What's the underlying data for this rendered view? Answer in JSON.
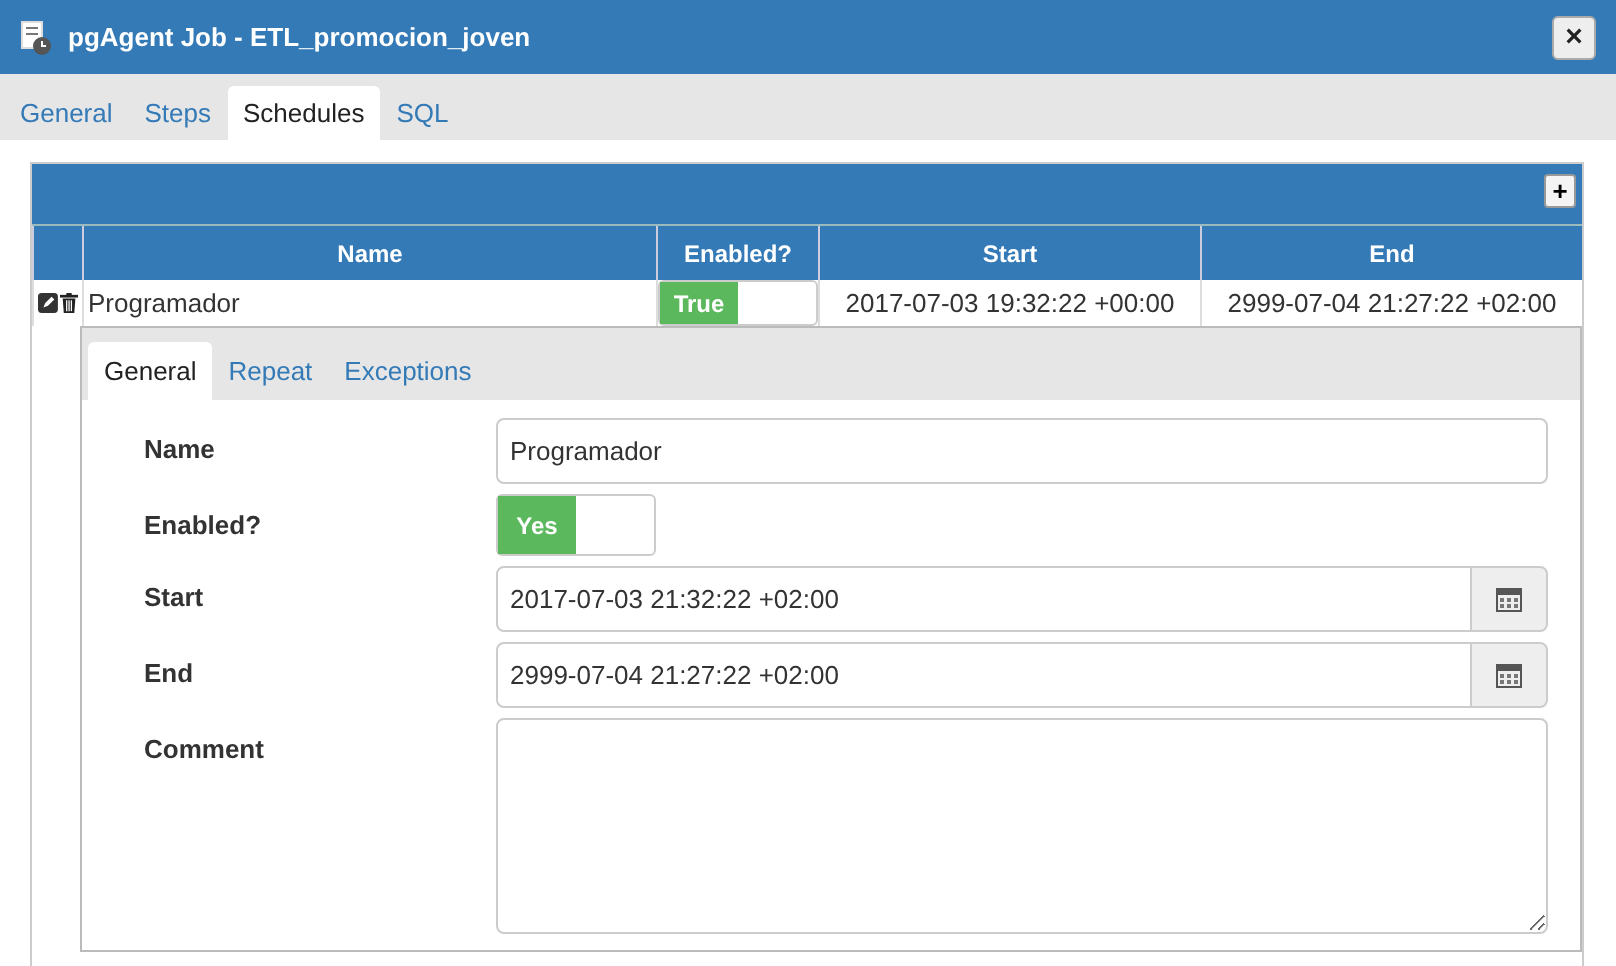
{
  "window": {
    "title": "pgAgent Job - ETL_promocion_joven",
    "close": "×"
  },
  "tabs": [
    {
      "label": "General",
      "selected": false
    },
    {
      "label": "Steps",
      "selected": false
    },
    {
      "label": "Schedules",
      "selected": true
    },
    {
      "label": "SQL",
      "selected": false
    }
  ],
  "grid": {
    "add": "+",
    "columns": [
      "Name",
      "Enabled?",
      "Start",
      "End"
    ],
    "rows": [
      {
        "name": "Programador",
        "enabled": {
          "label": "True",
          "on": true
        },
        "start": "2017-07-03 19:32:22 +00:00",
        "end": "2999-07-04 21:27:22 +02:00"
      }
    ]
  },
  "subtabs": [
    {
      "label": "General",
      "selected": true
    },
    {
      "label": "Repeat",
      "selected": false
    },
    {
      "label": "Exceptions",
      "selected": false
    }
  ],
  "form": [
    {
      "kind": "text",
      "label": "Name",
      "value": "Programador"
    },
    {
      "kind": "switch",
      "label": "Enabled?",
      "value": "Yes",
      "on": true
    },
    {
      "kind": "date",
      "label": "Start",
      "value": "2017-07-03 21:32:22 +02:00"
    },
    {
      "kind": "date",
      "label": "End",
      "value": "2999-07-04 21:27:22 +02:00"
    },
    {
      "kind": "textarea",
      "label": "Comment"
    }
  ]
}
